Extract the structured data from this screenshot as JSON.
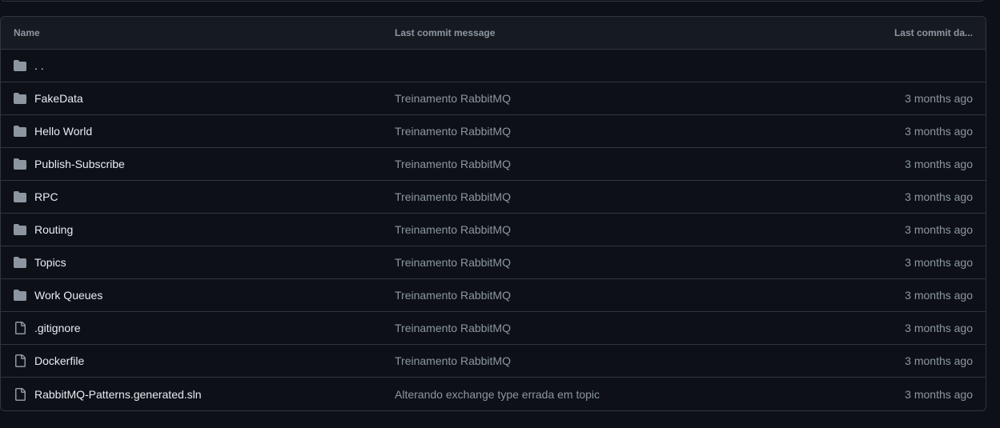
{
  "header": {
    "name": "Name",
    "message": "Last commit message",
    "date": "Last commit da..."
  },
  "parent": {
    "label": ". ."
  },
  "rows": [
    {
      "name": "FakeData",
      "type": "folder",
      "message": "Treinamento RabbitMQ",
      "date": "3 months ago"
    },
    {
      "name": "Hello World",
      "type": "folder",
      "message": "Treinamento RabbitMQ",
      "date": "3 months ago"
    },
    {
      "name": "Publish-Subscribe",
      "type": "folder",
      "message": "Treinamento RabbitMQ",
      "date": "3 months ago"
    },
    {
      "name": "RPC",
      "type": "folder",
      "message": "Treinamento RabbitMQ",
      "date": "3 months ago"
    },
    {
      "name": "Routing",
      "type": "folder",
      "message": "Treinamento RabbitMQ",
      "date": "3 months ago"
    },
    {
      "name": "Topics",
      "type": "folder",
      "message": "Treinamento RabbitMQ",
      "date": "3 months ago"
    },
    {
      "name": "Work Queues",
      "type": "folder",
      "message": "Treinamento RabbitMQ",
      "date": "3 months ago"
    },
    {
      "name": ".gitignore",
      "type": "file",
      "message": "Treinamento RabbitMQ",
      "date": "3 months ago"
    },
    {
      "name": "Dockerfile",
      "type": "file",
      "message": "Treinamento RabbitMQ",
      "date": "3 months ago"
    },
    {
      "name": "RabbitMQ-Patterns.generated.sln",
      "type": "file",
      "message": "Alterando exchange type errada em topic",
      "date": "3 months ago"
    }
  ],
  "icons": {
    "folder": "folder-icon",
    "file": "file-icon"
  },
  "colors": {
    "background": "#0d1117",
    "border": "#30363d",
    "text": "#e6edf3",
    "muted": "#8d96a0"
  }
}
